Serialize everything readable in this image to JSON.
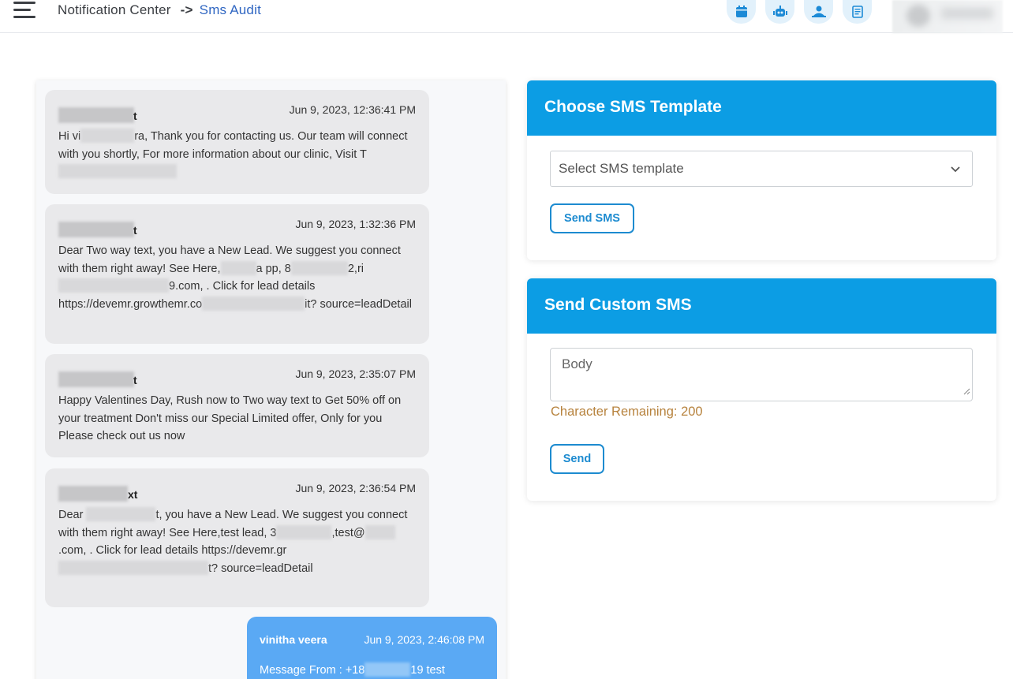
{
  "header": {
    "crumb_root": "Notification Center",
    "crumb_sep": "->",
    "crumb_current": "Sms Audit",
    "icons": [
      "calendar-icon",
      "robot-icon",
      "support-agent-icon",
      "document-icon"
    ]
  },
  "messages": [
    {
      "sender_tail": "t",
      "time": "Jun 9, 2023, 12:36:41 PM",
      "parts": [
        "Hi vi",
        "ra, Thank you for contacting us. Our team will connect with you shortly, For more information about our clinic, Visit T"
      ]
    },
    {
      "sender_tail": "t",
      "time": "Jun 9, 2023, 1:32:36 PM",
      "parts": [
        "Dear Two way text, you have a New Lead. We suggest you connect with them right away! See Here,",
        "a pp, 8",
        "2,ri",
        "9.com, . Click for lead details https://devemr.growthemr.co",
        "it? source=leadDetail"
      ]
    },
    {
      "sender_tail": "t",
      "time": "Jun 9, 2023, 2:35:07 PM",
      "parts": [
        "Happy Valentines Day, Rush now to Two way text to Get 50% off on your treatment Don't miss our Special Limited offer, Only for you Please check out us now"
      ]
    },
    {
      "sender_tail": "xt",
      "time": "Jun 9, 2023, 2:36:54 PM",
      "parts": [
        "Dear ",
        "t, you have a New Lead. We suggest you connect with them right away! See Here,test lead, 3",
        ",test@",
        ".com, . Click for lead details https://devemr.gr",
        "t? source=leadDetail"
      ]
    },
    {
      "sender": "vinitha veera",
      "time": "Jun 9, 2023, 2:46:08 PM",
      "parts": [
        "Message From : +18",
        "19 test"
      ]
    }
  ],
  "template_card": {
    "title": "Choose SMS Template",
    "select_placeholder": "Select SMS template",
    "send_label": "Send SMS"
  },
  "custom_card": {
    "title": "Send Custom SMS",
    "body_placeholder": "Body",
    "remaining": "Character Remaining: 200",
    "send_label": "Send"
  },
  "colors": {
    "accent": "#0c9de4",
    "outgoing_bubble": "#5aa9f4",
    "incoming_bubble": "#e9e9eb",
    "remaining_text": "#b7833e",
    "link": "#2f66c2"
  }
}
